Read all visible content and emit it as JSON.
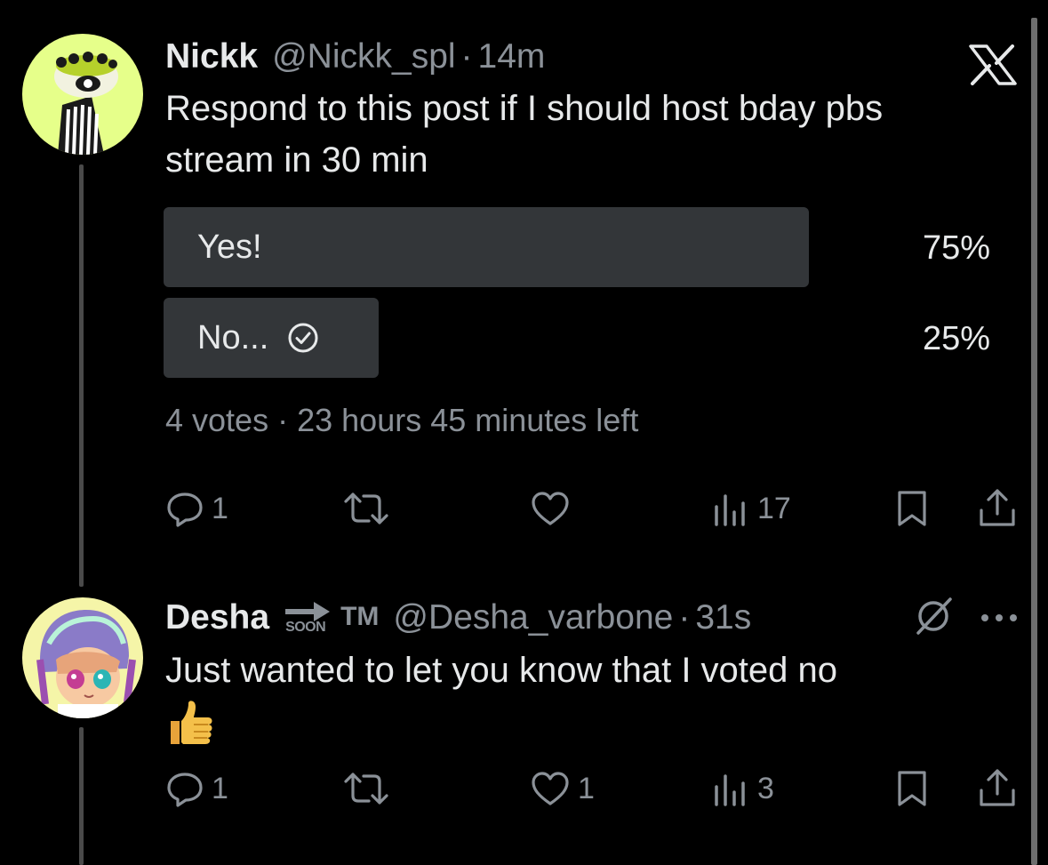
{
  "post": {
    "author_name": "Nickk",
    "handle": "@Nickk_spl",
    "separator": "·",
    "time": "14m",
    "text_line1": "Respond to this post if I should host bday pbs",
    "text_line2": "stream in 30 min",
    "poll": {
      "options": [
        {
          "label": "Yes!",
          "percent_text": "75%",
          "percent": 75,
          "selected": false
        },
        {
          "label": "No...",
          "percent_text": "25%",
          "percent": 25,
          "selected": true
        }
      ],
      "votes": "4 votes",
      "separator": "·",
      "time_left": "23 hours 45 minutes left"
    },
    "actions": {
      "reply_count": "1",
      "repost_count": "",
      "like_count": "",
      "views_count": "17"
    }
  },
  "reply": {
    "author_name": "Desha",
    "badge_text": "TM",
    "badge_soon": "SOON",
    "handle": "@Desha_varbone",
    "separator": "·",
    "time": "31s",
    "text_line1": "Just wanted to let you know that I voted no",
    "emoji": "👍",
    "actions": {
      "reply_count": "1",
      "repost_count": "",
      "like_count": "1",
      "views_count": "3"
    }
  },
  "colors": {
    "background": "#000000",
    "text": "#e7e9ea",
    "muted": "#8b9198",
    "poll_bar": "#333639",
    "avatar1_bg": "#e6ff8a",
    "avatar2_bg": "#f5f5a8"
  },
  "icons": [
    "x-logo-icon",
    "reply-icon",
    "repost-icon",
    "like-icon",
    "views-icon",
    "bookmark-icon",
    "share-icon",
    "check-circle-icon",
    "grok-icon",
    "more-icon",
    "arrow-soon-icon"
  ]
}
